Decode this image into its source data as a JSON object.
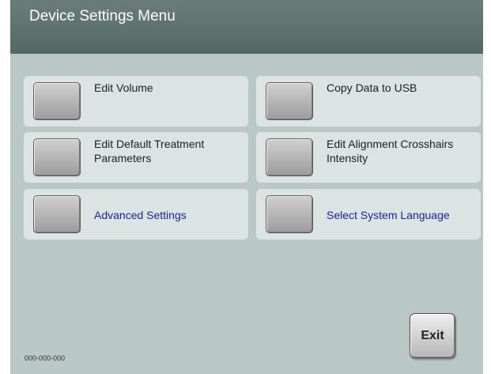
{
  "header": {
    "title": "Device Settings Menu"
  },
  "menu": [
    {
      "label": "Edit Volume"
    },
    {
      "label": "Copy Data to USB"
    },
    {
      "label": "Edit Default Treatment Parameters"
    },
    {
      "label": "Edit Alignment Crosshairs Intensity"
    },
    {
      "label": "Advanced Settings"
    },
    {
      "label": "Select System Language"
    }
  ],
  "exit_label": "Exit",
  "footer": {
    "id_text": "000-000-000"
  }
}
